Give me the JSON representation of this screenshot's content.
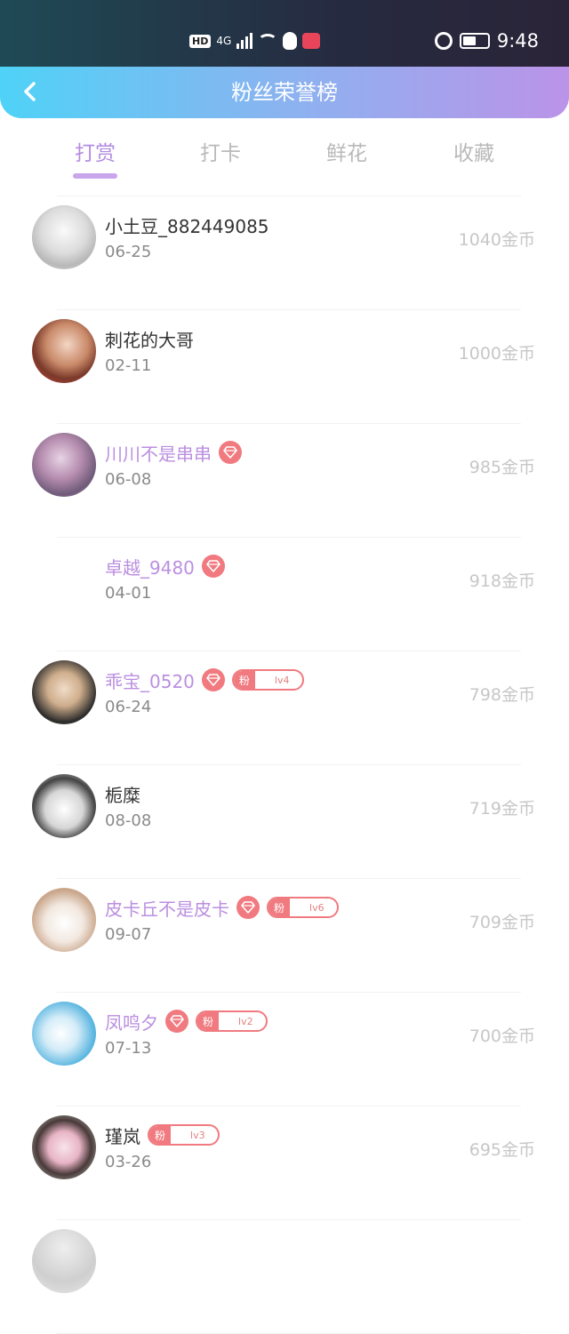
{
  "status_bar": {
    "network_badge": "HD",
    "network_type": "4G",
    "time": "9:48"
  },
  "header": {
    "title": "粉丝荣誉榜",
    "back_icon": "chevron-left-icon"
  },
  "tabs": [
    {
      "label": "打赏",
      "active": true
    },
    {
      "label": "打卡",
      "active": false
    },
    {
      "label": "鲜花",
      "active": false
    },
    {
      "label": "收藏",
      "active": false
    }
  ],
  "colors": {
    "accent": "#b38ce0",
    "header_start": "#4fd2f7",
    "header_end": "#bb93e8",
    "badge": "#f07a7f"
  },
  "fan_badge_label": "粉",
  "rows": [
    {
      "name": "小土豆_882449085",
      "date": "06-25",
      "amount": "1040金币",
      "vip": false,
      "diamond": false,
      "level": "",
      "avatar": "sketch-girl"
    },
    {
      "name": "刺花的大哥",
      "date": "02-11",
      "amount": "1000金币",
      "vip": false,
      "diamond": false,
      "level": "",
      "avatar": "anime-boy"
    },
    {
      "name": "川川不是串串",
      "date": "06-08",
      "amount": "985金币",
      "vip": true,
      "diamond": true,
      "level": "",
      "avatar": "purple-anime"
    },
    {
      "name": "卓越_9480",
      "date": "04-01",
      "amount": "918金币",
      "vip": true,
      "diamond": true,
      "level": "",
      "avatar": "none"
    },
    {
      "name": "乖宝_0520",
      "date": "06-24",
      "amount": "798金币",
      "vip": true,
      "diamond": true,
      "level": "lv4",
      "avatar": "blonde-girl"
    },
    {
      "name": "栀糜",
      "date": "08-08",
      "amount": "719金币",
      "vip": false,
      "diamond": false,
      "level": "",
      "avatar": "manga-hat"
    },
    {
      "name": "皮卡丘不是皮卡",
      "date": "09-07",
      "amount": "709金币",
      "vip": true,
      "diamond": true,
      "level": "lv6",
      "avatar": "cat"
    },
    {
      "name": "凤鸣夕",
      "date": "07-13",
      "amount": "700金币",
      "vip": true,
      "diamond": true,
      "level": "lv2",
      "avatar": "blue-anime"
    },
    {
      "name": "瑾岚",
      "date": "03-26",
      "amount": "695金币",
      "vip": false,
      "diamond": false,
      "level": "lv3",
      "avatar": "cat-ear-girl"
    }
  ]
}
